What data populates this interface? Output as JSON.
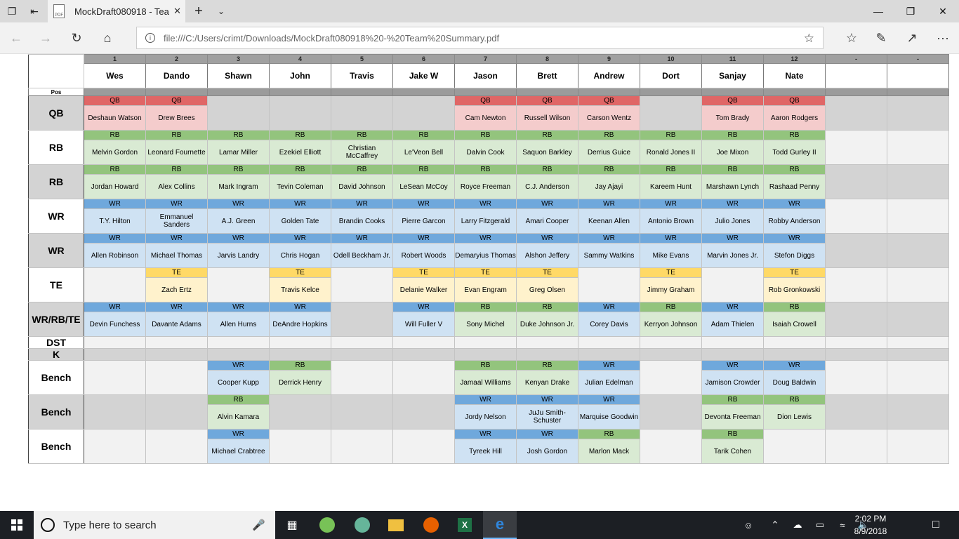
{
  "browser": {
    "tab_title": "MockDraft080918 - Tea",
    "pdf_badge": "PDF",
    "address": "file:///C:/Users/crimt/Downloads/MockDraft080918%20-%20Team%20Summary.pdf"
  },
  "sheet": {
    "team_numbers": [
      "1",
      "2",
      "3",
      "4",
      "5",
      "6",
      "7",
      "8",
      "9",
      "10",
      "11",
      "12",
      "-",
      "-"
    ],
    "team_names": [
      "Wes",
      "Dando",
      "Shawn",
      "John",
      "Travis",
      "Jake W",
      "Jason",
      "Brett",
      "Andrew",
      "Dort",
      "Sanjay",
      "Nate",
      "",
      ""
    ],
    "pos_header": "Pos",
    "rows": [
      {
        "label": "QB",
        "cells": [
          [
            "QB",
            "Deshaun Watson"
          ],
          [
            "QB",
            "Drew Brees"
          ],
          null,
          null,
          null,
          null,
          [
            "QB",
            "Cam Newton"
          ],
          [
            "QB",
            "Russell Wilson"
          ],
          [
            "QB",
            "Carson Wentz"
          ],
          null,
          [
            "QB",
            "Tom Brady"
          ],
          [
            "QB",
            "Aaron Rodgers"
          ],
          null,
          null
        ]
      },
      {
        "label": "RB",
        "cells": [
          [
            "RB",
            "Melvin Gordon"
          ],
          [
            "RB",
            "Leonard Fournette"
          ],
          [
            "RB",
            "Lamar Miller"
          ],
          [
            "RB",
            "Ezekiel Elliott"
          ],
          [
            "RB",
            "Christian McCaffrey"
          ],
          [
            "RB",
            "Le'Veon Bell"
          ],
          [
            "RB",
            "Dalvin Cook"
          ],
          [
            "RB",
            "Saquon Barkley"
          ],
          [
            "RB",
            "Derrius Guice"
          ],
          [
            "RB",
            "Ronald Jones II"
          ],
          [
            "RB",
            "Joe Mixon"
          ],
          [
            "RB",
            "Todd Gurley II"
          ],
          null,
          null
        ]
      },
      {
        "label": "RB",
        "cells": [
          [
            "RB",
            "Jordan Howard"
          ],
          [
            "RB",
            "Alex Collins"
          ],
          [
            "RB",
            "Mark Ingram"
          ],
          [
            "RB",
            "Tevin Coleman"
          ],
          [
            "RB",
            "David Johnson"
          ],
          [
            "RB",
            "LeSean McCoy"
          ],
          [
            "RB",
            "Royce Freeman"
          ],
          [
            "RB",
            "C.J. Anderson"
          ],
          [
            "RB",
            "Jay Ajayi"
          ],
          [
            "RB",
            "Kareem Hunt"
          ],
          [
            "RB",
            "Marshawn Lynch"
          ],
          [
            "RB",
            "Rashaad Penny"
          ],
          null,
          null
        ]
      },
      {
        "label": "WR",
        "cells": [
          [
            "WR",
            "T.Y. Hilton"
          ],
          [
            "WR",
            "Emmanuel Sanders"
          ],
          [
            "WR",
            "A.J. Green"
          ],
          [
            "WR",
            "Golden Tate"
          ],
          [
            "WR",
            "Brandin Cooks"
          ],
          [
            "WR",
            "Pierre Garcon"
          ],
          [
            "WR",
            "Larry Fitzgerald"
          ],
          [
            "WR",
            "Amari Cooper"
          ],
          [
            "WR",
            "Keenan Allen"
          ],
          [
            "WR",
            "Antonio Brown"
          ],
          [
            "WR",
            "Julio Jones"
          ],
          [
            "WR",
            "Robby Anderson"
          ],
          null,
          null
        ]
      },
      {
        "label": "WR",
        "cells": [
          [
            "WR",
            "Allen Robinson"
          ],
          [
            "WR",
            "Michael Thomas"
          ],
          [
            "WR",
            "Jarvis Landry"
          ],
          [
            "WR",
            "Chris Hogan"
          ],
          [
            "WR",
            "Odell Beckham Jr."
          ],
          [
            "WR",
            "Robert Woods"
          ],
          [
            "WR",
            "Demaryius Thomas"
          ],
          [
            "WR",
            "Alshon Jeffery"
          ],
          [
            "WR",
            "Sammy Watkins"
          ],
          [
            "WR",
            "Mike Evans"
          ],
          [
            "WR",
            "Marvin Jones Jr."
          ],
          [
            "WR",
            "Stefon Diggs"
          ],
          null,
          null
        ]
      },
      {
        "label": "TE",
        "cells": [
          null,
          [
            "TE",
            "Zach Ertz"
          ],
          null,
          [
            "TE",
            "Travis Kelce"
          ],
          null,
          [
            "TE",
            "Delanie Walker"
          ],
          [
            "TE",
            "Evan Engram"
          ],
          [
            "TE",
            "Greg Olsen"
          ],
          null,
          [
            "TE",
            "Jimmy Graham"
          ],
          null,
          [
            "TE",
            "Rob Gronkowski"
          ],
          null,
          null
        ]
      },
      {
        "label": "WR/RB/TE",
        "cells": [
          [
            "WR",
            "Devin Funchess"
          ],
          [
            "WR",
            "Davante Adams"
          ],
          [
            "WR",
            "Allen Hurns"
          ],
          [
            "WR",
            "DeAndre Hopkins"
          ],
          null,
          [
            "WR",
            "Will Fuller V"
          ],
          [
            "RB",
            "Sony Michel"
          ],
          [
            "RB",
            "Duke Johnson Jr."
          ],
          [
            "WR",
            "Corey Davis"
          ],
          [
            "RB",
            "Kerryon Johnson"
          ],
          [
            "WR",
            "Adam Thielen"
          ],
          [
            "RB",
            "Isaiah Crowell"
          ],
          null,
          null
        ]
      },
      {
        "label": "DST",
        "cells": [
          null,
          null,
          null,
          null,
          null,
          null,
          null,
          null,
          null,
          null,
          null,
          null,
          null,
          null
        ]
      },
      {
        "label": "K",
        "cells": [
          null,
          null,
          null,
          null,
          null,
          null,
          null,
          null,
          null,
          null,
          null,
          null,
          null,
          null
        ]
      },
      {
        "label": "Bench",
        "cells": [
          null,
          null,
          [
            "WR",
            "Cooper Kupp"
          ],
          [
            "RB",
            "Derrick Henry"
          ],
          null,
          null,
          [
            "RB",
            "Jamaal Williams"
          ],
          [
            "RB",
            "Kenyan Drake"
          ],
          [
            "WR",
            "Julian Edelman"
          ],
          null,
          [
            "WR",
            "Jamison Crowder"
          ],
          [
            "WR",
            "Doug Baldwin"
          ],
          null,
          null
        ]
      },
      {
        "label": "Bench",
        "cells": [
          null,
          null,
          [
            "RB",
            "Alvin Kamara"
          ],
          null,
          null,
          null,
          [
            "WR",
            "Jordy Nelson"
          ],
          [
            "WR",
            "JuJu Smith-Schuster"
          ],
          [
            "WR",
            "Marquise Goodwin"
          ],
          null,
          [
            "RB",
            "Devonta Freeman"
          ],
          [
            "RB",
            "Dion Lewis"
          ],
          null,
          null
        ]
      },
      {
        "label": "Bench",
        "cells": [
          null,
          null,
          [
            "WR",
            "Michael Crabtree"
          ],
          null,
          null,
          null,
          [
            "WR",
            "Tyreek Hill"
          ],
          [
            "WR",
            "Josh Gordon"
          ],
          [
            "RB",
            "Marlon Mack"
          ],
          null,
          [
            "RB",
            "Tarik Cohen"
          ],
          null,
          null,
          null
        ]
      }
    ]
  },
  "taskbar": {
    "search_placeholder": "Type here to search",
    "time": "2:02 PM",
    "date": "8/9/2018",
    "apps": [
      "android-studio-icon",
      "atom-icon",
      "file-explorer-icon",
      "firefox-icon",
      "excel-icon",
      "edge-icon"
    ]
  },
  "colors": {
    "QB": "#e06666",
    "RB": "#93c47d",
    "WR": "#6fa8dc",
    "TE": "#ffd966"
  }
}
